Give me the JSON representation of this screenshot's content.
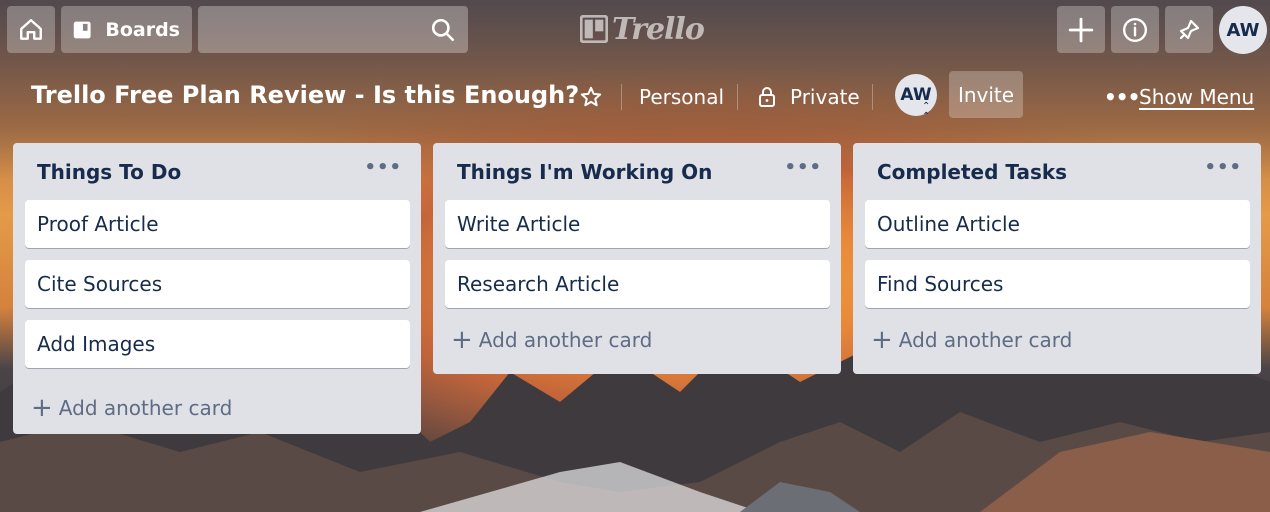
{
  "topbar": {
    "home_icon": "home-icon",
    "boards_label": "Boards",
    "search_placeholder": "",
    "logo_text": "Trello",
    "create_icon": "plus-icon",
    "info_icon": "info-icon",
    "notifications_icon": "bell-icon",
    "user_initials": "AW"
  },
  "board": {
    "title": "Trello Free Plan Review - Is this Enough?",
    "team_label": "Personal",
    "visibility_label": "Private",
    "member_initials": "AW",
    "invite_label": "Invite",
    "menu_dots": "•••",
    "show_menu_label": "Show Menu"
  },
  "lists": [
    {
      "title": "Things To Do",
      "menu": "•••",
      "cards": [
        "Proof Article",
        "Cite Sources",
        "Add Images"
      ],
      "add_label": "Add another card"
    },
    {
      "title": "Things I'm Working On",
      "menu": "•••",
      "cards": [
        "Write Article",
        "Research Article"
      ],
      "add_label": "Add another card"
    },
    {
      "title": "Completed Tasks",
      "menu": "•••",
      "cards": [
        "Outline Article",
        "Find Sources"
      ],
      "add_label": "Add another card"
    }
  ],
  "colors": {
    "list_bg": "#dfe1e6",
    "card_text": "#172b4d",
    "muted_text": "#5e6c84"
  }
}
